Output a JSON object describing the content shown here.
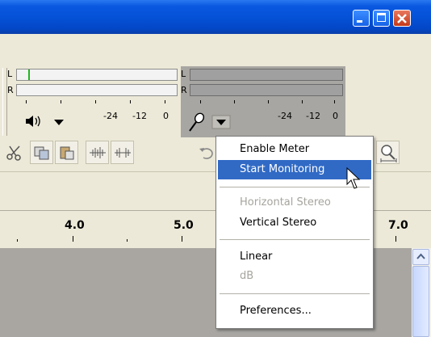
{
  "meters": {
    "playback": {
      "channels": [
        "L",
        "R"
      ],
      "scale": [
        "-24",
        "-12",
        "0"
      ]
    },
    "record": {
      "channels": [
        "L",
        "R"
      ],
      "scale": [
        "-24",
        "-12",
        "0"
      ]
    }
  },
  "ruler": {
    "labels": [
      "4.0",
      "5.0",
      "7.0"
    ]
  },
  "menu": {
    "items": [
      {
        "label": "Enable Meter",
        "state": "normal"
      },
      {
        "label": "Start Monitoring",
        "state": "highlighted"
      },
      {
        "label": "Horizontal Stereo",
        "state": "disabled"
      },
      {
        "label": "Vertical Stereo",
        "state": "normal"
      },
      {
        "label": "Linear",
        "state": "normal"
      },
      {
        "label": "dB",
        "state": "disabled"
      },
      {
        "label": "Preferences...",
        "state": "normal"
      }
    ]
  },
  "icons": {
    "speaker": "speaker-icon",
    "mic": "microphone-icon",
    "dropdown": "chevron-down-icon"
  },
  "colors": {
    "titlebar": "#0552d8",
    "menu_highlight": "#316ac5",
    "meter_level": "#22b322"
  }
}
